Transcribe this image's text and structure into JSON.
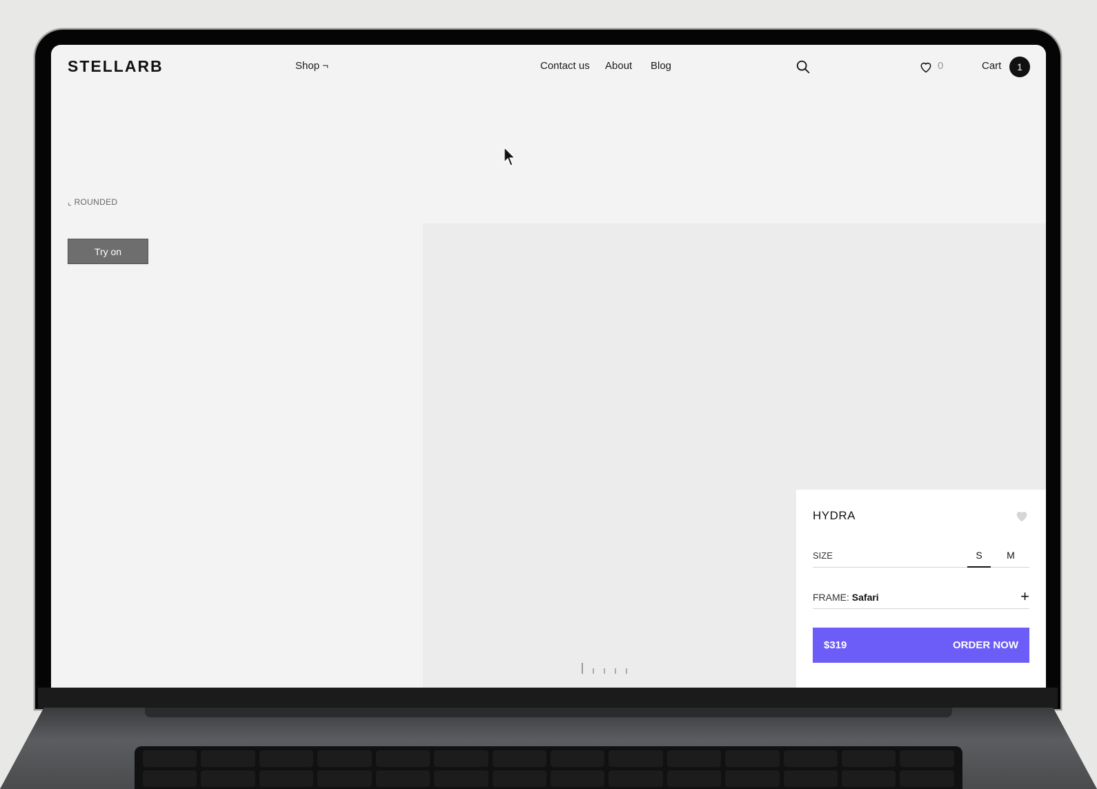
{
  "brand": {
    "logo": "STELLARB"
  },
  "nav": {
    "shop": "Shop ¬",
    "contact": "Contact us",
    "about": "About",
    "blog": "Blog"
  },
  "header": {
    "wishlist_count": "0",
    "cart_label": "Cart",
    "cart_count": "1"
  },
  "product": {
    "tag": "ROUNDED",
    "tag_prefix": "⌞",
    "try_on_label": "Try on",
    "name": "HYDRA",
    "size_label": "SIZE",
    "sizes": [
      "S",
      "M"
    ],
    "selected_size": "S",
    "frame_label": "FRAME:",
    "frame_value": "Safari",
    "price": "$319",
    "order_label": "ORDER NOW"
  },
  "colors": {
    "accent": "#6c5cf8",
    "background": "#f2f3f2",
    "gallery": "#ebeceb"
  },
  "gallery": {
    "slide_count": 5,
    "active_slide": 1
  }
}
